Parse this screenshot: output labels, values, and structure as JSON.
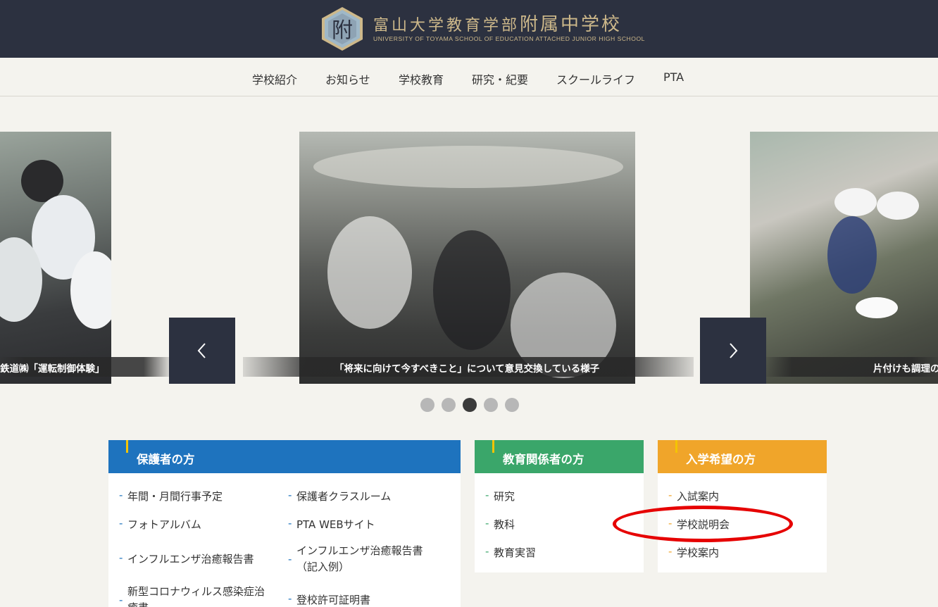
{
  "header": {
    "title_main": "富山大学教育学部",
    "title_school": "附属中学校",
    "subtitle": "UNIVERSITY OF TOYAMA SCHOOL OF EDUCATION ATTACHED JUNIOR HIGH SCHOOL",
    "emblem_char": "附"
  },
  "nav": {
    "items": [
      "学校紹介",
      "お知らせ",
      "学校教育",
      "研究・紀要",
      "スクールライフ",
      "PTA"
    ]
  },
  "slider": {
    "captions": {
      "left": "鉄道㈱「運転制御体験」",
      "center": "「将来に向けて今すべきこと」について意見交換している様子",
      "right": "片付けも調理の"
    },
    "dot_count": 5,
    "active_dot": 3
  },
  "cards": {
    "parents": {
      "title": "保護者の方",
      "color": "#1e73be",
      "links": [
        "年間・月間行事予定",
        "保護者クラスルーム",
        "フォトアルバム",
        "PTA WEBサイト",
        "インフルエンザ治癒報告書",
        "インフルエンザ治癒報告書",
        "（記入例）",
        "新型コロナウィルス感染症治",
        "癒書",
        "登校許可証明書"
      ]
    },
    "educators": {
      "title": "教育関係者の方",
      "color": "#3aa66a",
      "links": [
        "研究",
        "教科",
        "教育実習"
      ]
    },
    "applicants": {
      "title": "入学希望の方",
      "color": "#f0a52a",
      "links": [
        "入試案内",
        "学校説明会",
        "学校案内"
      ]
    }
  },
  "colors": {
    "header_bg": "#2c3140",
    "gold": "#cdb88a",
    "page_bg": "#f4f3ee",
    "highlight_ellipse": "#e60000"
  }
}
